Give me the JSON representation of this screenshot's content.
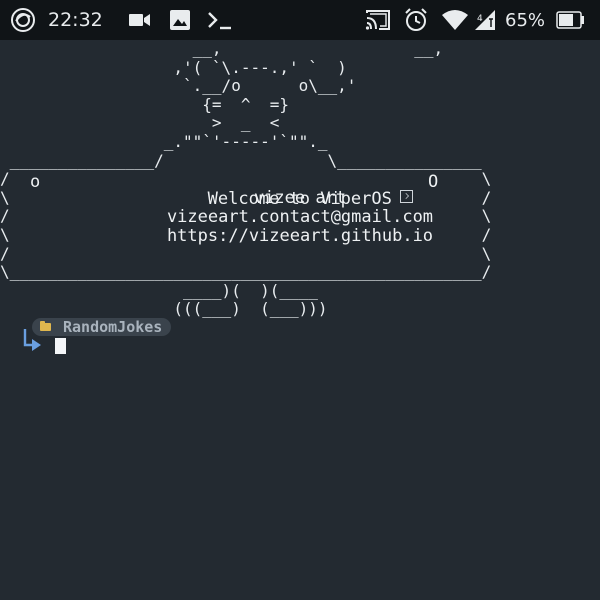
{
  "status_bar": {
    "time": "22:32",
    "battery": "65%",
    "left_icons": [
      "record-icon",
      "video-icon",
      "image-icon",
      "terminal-icon"
    ],
    "right_icons": [
      "cast-icon",
      "alarm-icon",
      "wifi-icon",
      "signal-icon",
      "battery-icon"
    ]
  },
  "terminal": {
    "ascii_art": "                    __,                    __,\n                  ,'( `\\.---.,' `  )\n                   `.__/o      o\\__,'\n                     {=  ^  =}\n                      >  _  <\n                 _.\"\"`'-----'`\"\"._\n _______________/                 \\_______________\n/                                                 \\\n\\                                                 /\n/                                                 \\\n\\                                                 /\n/                                                 \\\n\\_________________________________________________/\n                   ____)(  )(____\n                  (((___)  (___)))",
    "banner": {
      "o_left": "o",
      "o_right": "O",
      "welcome": "Welcome to ViperOS",
      "author": "vizee art",
      "email": "vizeeart.contact@gmail.com",
      "url": "https://vizeeart.github.io"
    },
    "prompt": {
      "folder_name": "RandomJokes"
    }
  },
  "colors": {
    "background": "#232a31",
    "status_bar": "#101417",
    "text": "#e8ecef",
    "badge_bg": "#3a434c",
    "badge_text": "#a9b3bd",
    "folder_icon": "#e0b74e",
    "prompt_arrow": "#6a9fe0"
  }
}
